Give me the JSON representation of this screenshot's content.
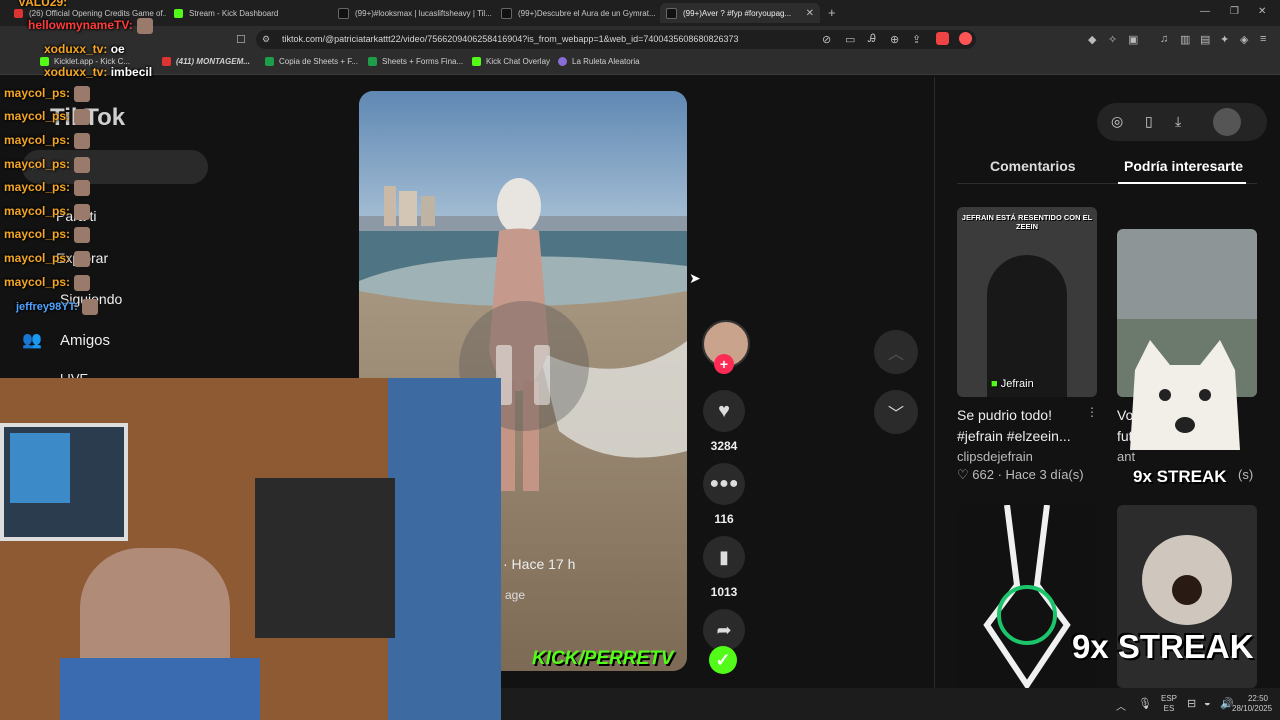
{
  "browser": {
    "tabs": [
      {
        "label": "(26) Official Opening Credits Game of...",
        "color": "#d33"
      },
      {
        "label": "Stream - Kick Dashboard",
        "color": "#53fc18"
      },
      {
        "label": "(99+)#looksmax | lucasliftsheavy | Til...",
        "color": "#111"
      },
      {
        "label": "(99+)Descubre el Aura de un Gymrat...",
        "color": "#111"
      },
      {
        "label": "(99+)Aver ? #fyp #foryoupag...",
        "color": "#111"
      }
    ],
    "new_tab": "+",
    "url": "tiktok.com/@patriciatarkattt22/video/7566209406258416904?is_from_webapp=1&web_id=7400435608680826373",
    "bookmarks": [
      {
        "label": "Kicklet.app - Kick C...",
        "color": "#53fc18"
      },
      {
        "label": "(411) MONTAGEM...",
        "color": "#d33"
      },
      {
        "label": "Copia de Sheets + F...",
        "color": "#1e9e4a"
      },
      {
        "label": "Sheets + Forms Fina...",
        "color": "#1e9e4a"
      },
      {
        "label": "Kick Chat Overlay",
        "color": "#53fc18"
      },
      {
        "label": "La Ruleta Aleatoria",
        "color": "#8a6cd6"
      }
    ]
  },
  "sidebar": {
    "logo": "TikTok",
    "items": [
      {
        "label": "Para ti"
      },
      {
        "label": "Explorar"
      },
      {
        "label": "Siguiendo"
      },
      {
        "label": "Amigos"
      },
      {
        "label": "LIVE"
      }
    ]
  },
  "video": {
    "meta_time": "· Hace 17 h",
    "meta_tag": "age"
  },
  "actions": {
    "likes": "3284",
    "comments": "116",
    "saves": "1013"
  },
  "right_panel": {
    "tabs": [
      "Comentarios",
      "Podría interesarte"
    ],
    "cards": [
      {
        "thumb_text": "JEFRAIN ESTÁ RESENTIDO CON EL ZEEIN",
        "channel_badge": "Jefrain",
        "title": "Se pudrio todo! #jefrain #elzeein...",
        "author": "clipsdejefrain",
        "likes": "662",
        "age": "Hace 3 día(s)"
      },
      {
        "thumb_text": "",
        "channel_badge": "",
        "title": "Vol futb",
        "author": "ant",
        "likes": "",
        "age": "(s)"
      }
    ]
  },
  "chat": [
    {
      "user": "VALU29:",
      "text": "",
      "color": "#f5a623"
    },
    {
      "user": "hellowmynameTV:",
      "text": "",
      "color": "#ff3b3b"
    },
    {
      "user": "xoduxx_tv:",
      "text": "oe",
      "color": "#f5a623"
    },
    {
      "user": "xoduxx_tv:",
      "text": "imbecil",
      "color": "#f5a623"
    },
    {
      "user": "maycol_ps:",
      "text": "",
      "color": "#f5a623"
    },
    {
      "user": "maycol_ps:",
      "text": "",
      "color": "#f5a623"
    },
    {
      "user": "maycol_ps:",
      "text": "",
      "color": "#f5a623"
    },
    {
      "user": "maycol_ps:",
      "text": "",
      "color": "#f5a623"
    },
    {
      "user": "maycol_ps:",
      "text": "",
      "color": "#f5a623"
    },
    {
      "user": "maycol_ps:",
      "text": "",
      "color": "#f5a623"
    },
    {
      "user": "maycol_ps:",
      "text": "",
      "color": "#f5a623"
    },
    {
      "user": "maycol_ps:",
      "text": "",
      "color": "#f5a623"
    },
    {
      "user": "maycol_ps:",
      "text": "",
      "color": "#f5a623"
    },
    {
      "user": "jeffrey98YT:",
      "text": "",
      "color": "#4da3ff"
    }
  ],
  "overlay": {
    "streak_small": "9x STREAK",
    "streak_big": "9x STREAK",
    "kick_brand": "KICK/PERRETV"
  },
  "taskbar": {
    "lang_top": "ESP",
    "lang_bottom": "ES",
    "time": "22:50",
    "date": "28/10/2025"
  }
}
